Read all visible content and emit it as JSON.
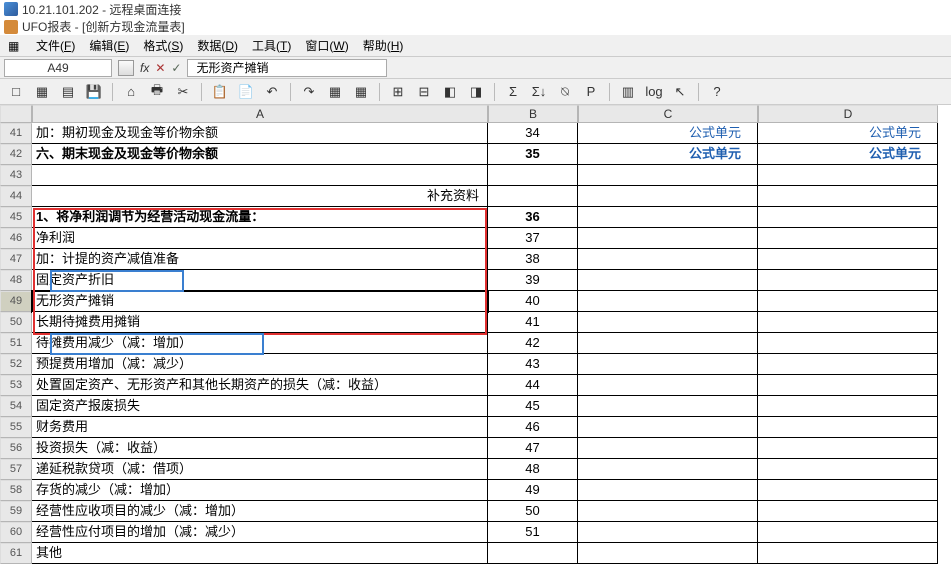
{
  "window": {
    "remote_title": "10.21.101.202 - 远程桌面连接",
    "app_title": "UFO报表 - [创新方现金流量表]"
  },
  "menus": [
    {
      "label": "文件",
      "key": "F"
    },
    {
      "label": "编辑",
      "key": "E"
    },
    {
      "label": "格式",
      "key": "S"
    },
    {
      "label": "数据",
      "key": "D"
    },
    {
      "label": "工具",
      "key": "T"
    },
    {
      "label": "窗口",
      "key": "W"
    },
    {
      "label": "帮助",
      "key": "H"
    }
  ],
  "cellbar": {
    "ref": "A49",
    "formula": "无形资产摊销"
  },
  "toolbar_icons": [
    "□",
    "▦",
    "▤",
    "💾",
    "⌂",
    "🖶",
    "✂",
    "📋",
    "📄",
    "↶",
    "↷",
    "▦",
    "▦",
    "⊞",
    "⊟",
    "◧",
    "◨",
    "Σ",
    "Σ↓",
    "⍉",
    "P",
    "▥",
    "log",
    "↖",
    "?"
  ],
  "columns": [
    "A",
    "B",
    "C",
    "D"
  ],
  "rows": [
    {
      "n": 41,
      "a": "        加：期初现金及现金等价物余额",
      "b": "34",
      "c": "公式单元",
      "d": "公式单元"
    },
    {
      "n": 42,
      "a": "六、期末现金及现金等价物余额",
      "b": "35",
      "c": "公式单元",
      "d": "公式单元",
      "bold": true
    },
    {
      "n": 43,
      "a": "",
      "b": "",
      "c": "",
      "d": ""
    },
    {
      "n": 44,
      "a": "",
      "b": "补充资料",
      "c": "",
      "d": "",
      "note": true
    },
    {
      "n": 45,
      "a": "1、将净利润调节为经营活动现金流量：",
      "b": "36",
      "c": "",
      "d": "",
      "bold": true
    },
    {
      "n": 46,
      "a": "净利润",
      "b": "37",
      "c": "",
      "d": ""
    },
    {
      "n": 47,
      "a": "加：计提的资产减值准备",
      "b": "38",
      "c": "",
      "d": ""
    },
    {
      "n": 48,
      "a": "        固定资产折旧",
      "b": "39",
      "c": "",
      "d": ""
    },
    {
      "n": 49,
      "a": "        无形资产摊销",
      "b": "40",
      "c": "",
      "d": "",
      "sel": true
    },
    {
      "n": 50,
      "a": "        长期待摊费用摊销",
      "b": "41",
      "c": "",
      "d": ""
    },
    {
      "n": 51,
      "a": "        待摊费用减少（减：增加）",
      "b": "42",
      "c": "",
      "d": ""
    },
    {
      "n": 52,
      "a": "        预提费用增加（减：减少）",
      "b": "43",
      "c": "",
      "d": ""
    },
    {
      "n": 53,
      "a": "        处置固定资产、无形资产和其他长期资产的损失（减：收益）",
      "b": "44",
      "c": "",
      "d": ""
    },
    {
      "n": 54,
      "a": "        固定资产报废损失",
      "b": "45",
      "c": "",
      "d": ""
    },
    {
      "n": 55,
      "a": "        财务费用",
      "b": "46",
      "c": "",
      "d": ""
    },
    {
      "n": 56,
      "a": "        投资损失（减：收益）",
      "b": "47",
      "c": "",
      "d": ""
    },
    {
      "n": 57,
      "a": "        递延税款贷项（减：借项）",
      "b": "48",
      "c": "",
      "d": ""
    },
    {
      "n": 58,
      "a": "        存货的减少（减：增加）",
      "b": "49",
      "c": "",
      "d": ""
    },
    {
      "n": 59,
      "a": "        经营性应收项目的减少（减：增加）",
      "b": "50",
      "c": "",
      "d": ""
    },
    {
      "n": 60,
      "a": "        经营性应付项目的增加（减：减少）",
      "b": "51",
      "c": "",
      "d": ""
    },
    {
      "n": 61,
      "a": "        其他",
      "b": "",
      "c": "",
      "d": ""
    }
  ]
}
